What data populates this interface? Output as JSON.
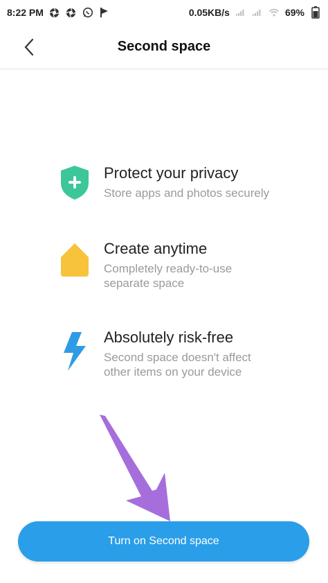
{
  "status_bar": {
    "time": "8:22 PM",
    "net_speed": "0.05KB/s",
    "battery": "69%"
  },
  "header": {
    "title": "Second space"
  },
  "features": [
    {
      "title": "Protect your privacy",
      "desc": [
        "Store apps and photos securely"
      ],
      "icon": "shield-plus-icon",
      "color": "#3ec69b"
    },
    {
      "title": "Create anytime",
      "desc": [
        "Completely ready-to-use",
        "separate space"
      ],
      "icon": "house-icon",
      "color": "#f7c33a"
    },
    {
      "title": "Absolutely risk-free",
      "desc": [
        "Second space doesn't affect",
        "other items on your device"
      ],
      "icon": "lightning-icon",
      "color": "#2e9be6"
    }
  ],
  "cta": {
    "label": "Turn on Second space",
    "color": "#2a9ee8"
  },
  "annotation_arrow_color": "#a166d9"
}
